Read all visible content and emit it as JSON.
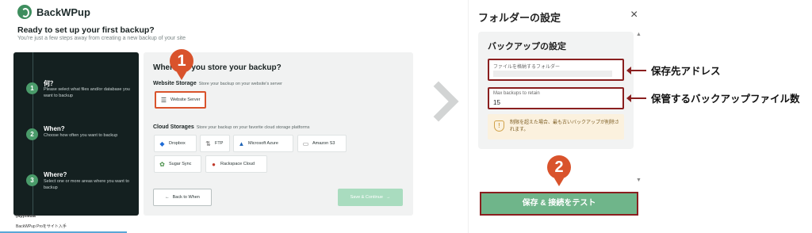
{
  "brand": {
    "name": "BackWPup"
  },
  "setup": {
    "heading": "Ready to set up your first backup?",
    "subheading": "You're just a few steps away from creating a new backup of your site"
  },
  "steps": [
    {
      "number": "1",
      "title": "何？",
      "desc": "Please select what files and/or database you want to backup"
    },
    {
      "number": "2",
      "title": "When?",
      "desc": "Choose how often you want to backup"
    },
    {
      "number": "3",
      "title": "Where?",
      "desc": "Select one or more areas where you want to backup"
    }
  ],
  "card": {
    "title": "Where do you store your backup?",
    "website_storage": {
      "label": "Website Storage",
      "note": "Store your backup on your website's server"
    },
    "website_server": "Website Server",
    "cloud": {
      "label": "Cloud Storages",
      "note": "Store your backup on your favorite cloud storage platforms"
    },
    "providers": [
      {
        "name": "Dropbox",
        "icon": "dropbox-icon"
      },
      {
        "name": "FTP",
        "icon": "ftp-icon"
      },
      {
        "name": "Microsoft Azure",
        "icon": "azure-icon"
      },
      {
        "name": "Amazon S3",
        "icon": "amazon-s3-icon"
      },
      {
        "name": "Sugar Sync",
        "icon": "sugarsync-icon"
      },
      {
        "name": "Rackspace Cloud",
        "icon": "rackspace-icon"
      }
    ],
    "back_label": "Back to When",
    "save_label": "Save & Continue"
  },
  "badges": {
    "first": "1",
    "second": "2"
  },
  "footer": {
    "logo": "(wp)media",
    "note": "BackWPup Proをサイト入手"
  },
  "dialog": {
    "title": "フォルダーの設定",
    "close": "×",
    "box_title": "バックアップの設定",
    "folder_field": {
      "label": "ファイルを格納するフォルダー",
      "value": ""
    },
    "max_field": {
      "label": "Max backups to retain",
      "value": "15"
    },
    "warning": "制限を超えた場合、最も古いバックアップが削除されます。",
    "test_button": "保存 & 接続をテスト"
  },
  "annotations": {
    "folder": "保存先アドレス",
    "max": "保管するバックアップファイル数"
  },
  "colors": {
    "accent_red": "#d9532c",
    "dark_panel": "#142020",
    "green": "#6fb58a",
    "outline_red": "#8a1f1f"
  }
}
